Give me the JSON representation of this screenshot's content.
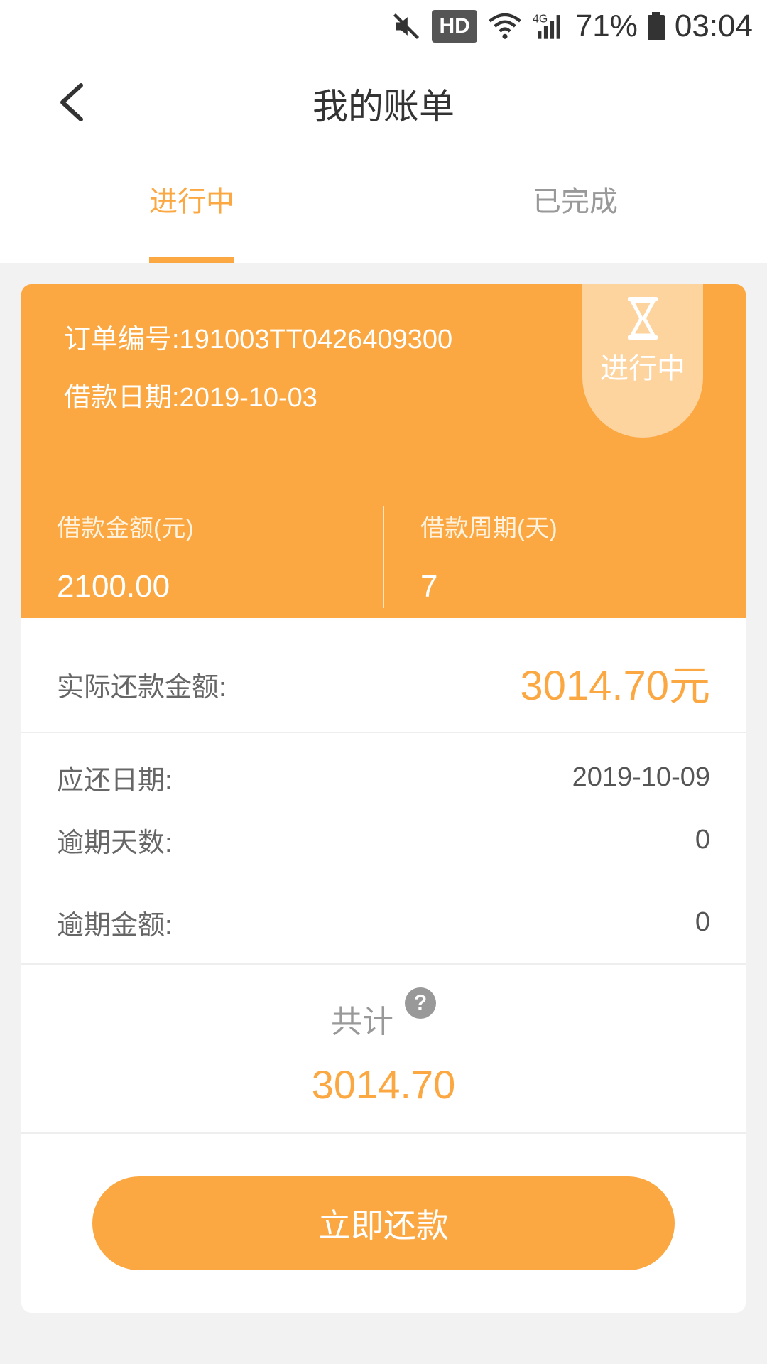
{
  "status_bar": {
    "hd": "HD",
    "network": "4G",
    "battery": "71%",
    "time": "03:04"
  },
  "header": {
    "title": "我的账单",
    "back_icon": "chevron-left-icon"
  },
  "tabs": [
    {
      "label": "进行中",
      "active": true
    },
    {
      "label": "已完成",
      "active": false
    }
  ],
  "order": {
    "order_no": "订单编号:191003TT0426409300",
    "loan_date": "借款日期:2019-10-03",
    "badge": "进行中",
    "loan_amount_label": "借款金额(元)",
    "loan_amount": "2100.00",
    "loan_period_label": "借款周期(天)",
    "loan_period": "7",
    "actual_label": "实际还款金额:",
    "actual_value": "3014.70元",
    "due_date_label": "应还日期:",
    "due_date": "2019-10-09",
    "overdue_days_label": "逾期天数:",
    "overdue_days": "0",
    "overdue_amount_label": "逾期金额:",
    "overdue_amount": "0",
    "total_label": "共计",
    "total_help": "?",
    "total_value": "3014.70"
  },
  "actions": {
    "repay_label": "立即还款"
  },
  "colors": {
    "accent": "#fca842",
    "badge_bg": "#fdd39e"
  }
}
